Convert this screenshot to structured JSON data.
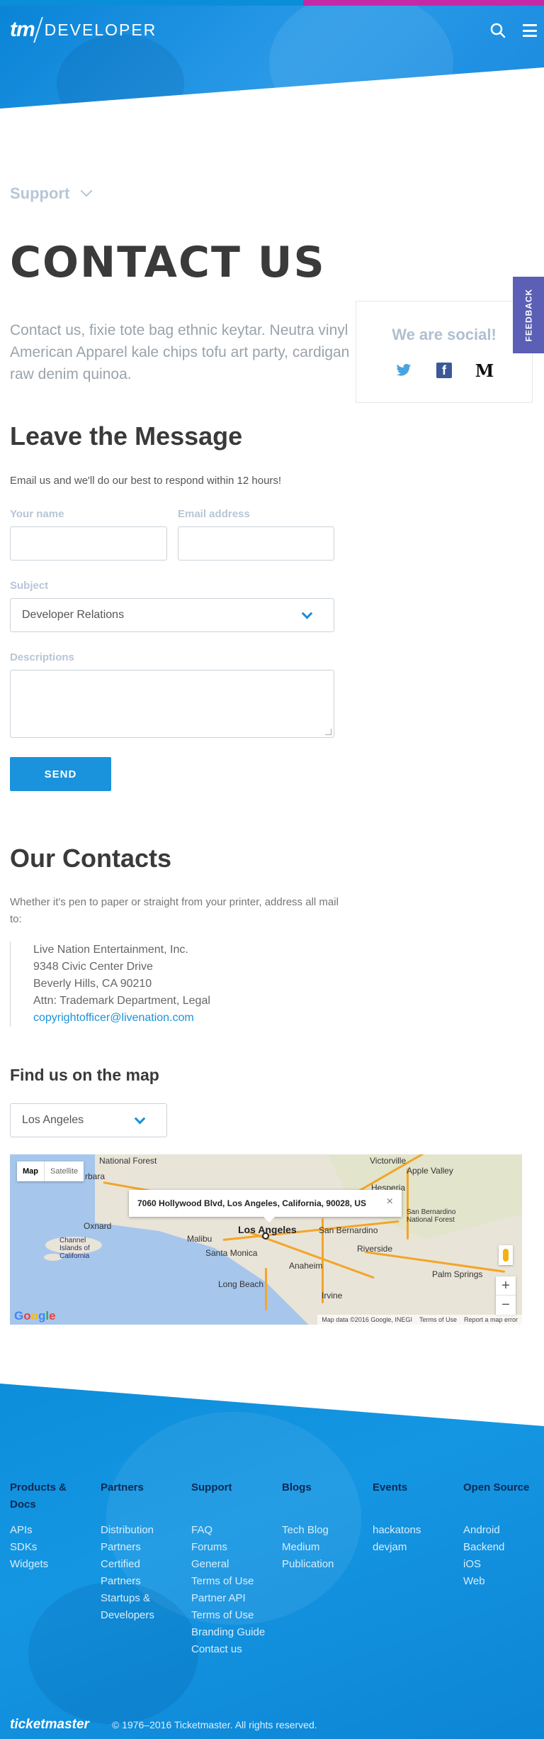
{
  "header": {
    "logo_tm": "tm",
    "logo_developer": "DEVELOPER",
    "search_icon": "search-icon",
    "menu_icon": "hamburger-menu-icon"
  },
  "support_dropdown": {
    "label": "Support"
  },
  "page_title": "CONTACT US",
  "intro": "Contact us, fixie tote bag ethnic keytar. Neutra vinyl American Apparel kale chips tofu art party, cardigan raw denim quinoa.",
  "social": {
    "title": "We are social!",
    "icons": [
      "twitter-icon",
      "facebook-icon",
      "medium-icon"
    ],
    "facebook_glyph": "f",
    "medium_glyph": "M"
  },
  "feedback_label": "FEEDBACK",
  "message": {
    "heading": "Leave the Message",
    "note": "Email us and we'll do our best to respond within 12 hours!",
    "name_label": "Your name",
    "name_value": "",
    "email_label": "Email address",
    "email_value": "",
    "subject_label": "Subject",
    "subject_value": "Developer Relations",
    "descriptions_label": "Descriptions",
    "descriptions_value": "",
    "send_label": "SEND"
  },
  "contacts": {
    "heading": "Our Contacts",
    "note": "Whether it's pen to paper or straight from your printer, address all mail to:",
    "address": [
      "Live Nation Entertainment, Inc.",
      "9348 Civic Center Drive",
      "Beverly Hills, CA 90210",
      "Attn: Trademark Department, Legal"
    ],
    "email": "copyrightofficer@livenation.com"
  },
  "map_section": {
    "heading": "Find us on the map",
    "city_select": "Los Angeles",
    "toggle_map": "Map",
    "toggle_satellite": "Satellite",
    "info_address": "7060 Hollywood Blvd, Los Angeles, California, 90028, US",
    "info_close": "×",
    "cities": {
      "victorville": "Victorville",
      "apple_valley": "Apple Valley",
      "hesperia": "Hesperia",
      "oxnard": "Oxnard",
      "malibu": "Malibu",
      "los_angeles": "Los Angeles",
      "san_bernardino": "San Bernardino",
      "santa_monica": "Santa Monica",
      "riverside": "Riverside",
      "anaheim": "Anaheim",
      "long_beach": "Long Beach",
      "irvine": "Irvine",
      "palm_springs": "Palm Springs",
      "channel_islands": "Channel Islands of California",
      "national_forest": "National Forest",
      "barbara": "rbara",
      "sb_forest": "San Bernardino National Forest"
    },
    "zoom_in": "+",
    "zoom_out": "−",
    "google_logo": "Google",
    "attribution": [
      "Map data ©2016 Google, INEGI",
      "Terms of Use",
      "Report a map error"
    ]
  },
  "footer": {
    "columns": [
      {
        "heading": "Products & Docs",
        "items": [
          "APIs",
          "SDKs",
          "Widgets"
        ]
      },
      {
        "heading": "Partners",
        "items": [
          "Distribution Partners",
          "Certified Partners",
          "Startups & Developers"
        ]
      },
      {
        "heading": "Support",
        "items": [
          "FAQ",
          "Forums",
          "General",
          "Terms of Use",
          "Partner API",
          "Terms of Use",
          "Branding Guide",
          "Contact us"
        ]
      },
      {
        "heading": "Blogs",
        "items": [
          "Tech Blog",
          "Medium",
          "Publication"
        ]
      },
      {
        "heading": "Events",
        "items": [
          "hackatons",
          "devjam"
        ]
      },
      {
        "heading": "Open Source",
        "items": [
          "Android",
          "Backend",
          "iOS",
          "Web"
        ]
      }
    ],
    "logo": "ticketmaster",
    "copyright": "© 1976–2016 Ticketmaster. All rights reserved."
  }
}
